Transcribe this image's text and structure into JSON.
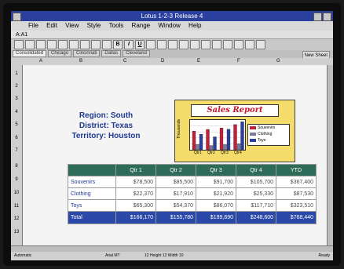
{
  "window": {
    "title": "Lotus 1-2-3 Release 4"
  },
  "menu": [
    "File",
    "Edit",
    "View",
    "Style",
    "Tools",
    "Range",
    "Window",
    "Help"
  ],
  "cell_ref": "A:A1",
  "tabs": [
    "Consolidated",
    "Chicago",
    "Cincinnati",
    "Dallas",
    "Cleveland"
  ],
  "new_sheet": "New Sheet",
  "columns": [
    "A",
    "B",
    "C",
    "D",
    "E",
    "F",
    "G"
  ],
  "rows": [
    "1",
    "2",
    "3",
    "4",
    "5",
    "6",
    "7",
    "8",
    "9",
    "10",
    "11",
    "12",
    "13"
  ],
  "region": {
    "line1": "Region: South",
    "line2": "District: Texas",
    "line3": "Territory: Houston"
  },
  "chart": {
    "title": "Sales Report",
    "ylabel": "Thousands",
    "categories": [
      "Qtr1",
      "Qtr2",
      "Qtr3",
      "Qtr4"
    ],
    "legend": [
      "Souvenirs",
      "Clothing",
      "Toys"
    ],
    "colors": [
      "#c21f3a",
      "#7a7a9e",
      "#2c3f9e"
    ]
  },
  "chart_data": {
    "type": "bar",
    "title": "Sales Report",
    "ylabel": "Thousands",
    "categories": [
      "Qtr1",
      "Qtr2",
      "Qtr3",
      "Qtr4"
    ],
    "series": [
      {
        "name": "Souvenirs",
        "values": [
          78.5,
          85.5,
          91.7,
          105.7
        ]
      },
      {
        "name": "Clothing",
        "values": [
          22.37,
          17.91,
          21.92,
          25.33
        ]
      },
      {
        "name": "Toys",
        "values": [
          65.3,
          54.37,
          86.07,
          117.71
        ]
      }
    ]
  },
  "table": {
    "header": [
      "",
      "Qtr 1",
      "Qtr 2",
      "Qtr 3",
      "Qtr 4",
      "YTD"
    ],
    "rows": [
      {
        "label": "Souvenirs",
        "values": [
          "$78,500",
          "$85,500",
          "$91,700",
          "$105,700",
          "$367,400"
        ]
      },
      {
        "label": "Clothing",
        "values": [
          "$22,370",
          "$17,910",
          "$21,920",
          "$25,330",
          "$87,530"
        ]
      },
      {
        "label": "Toys",
        "values": [
          "$65,300",
          "$54,370",
          "$86,070",
          "$117,710",
          "$323,510"
        ]
      }
    ],
    "total": {
      "label": "Total",
      "values": [
        "$166,170",
        "$155,780",
        "$199,690",
        "$248,600",
        "$768,440"
      ]
    }
  },
  "status": {
    "left": "Automatic",
    "mid1": "Arial MT",
    "mid2": "12 Height 12 Width 10",
    "right": "Ready"
  }
}
